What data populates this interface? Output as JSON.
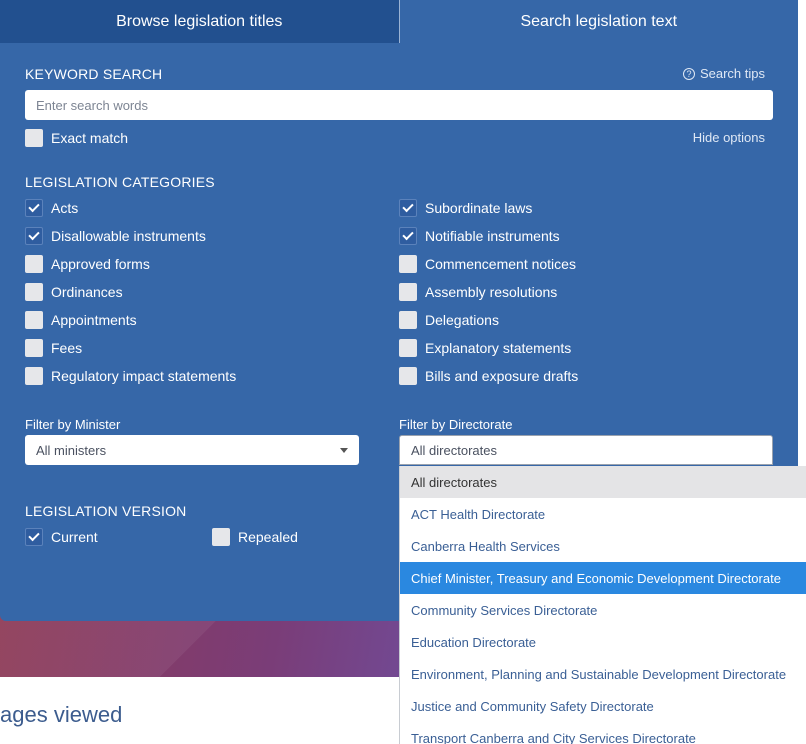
{
  "tabs": [
    {
      "label": "Browse legislation titles",
      "active": false
    },
    {
      "label": "Search legislation text",
      "active": true
    }
  ],
  "keyword_search": {
    "heading": "KEYWORD SEARCH",
    "search_tips": "Search tips",
    "placeholder": "Enter search words",
    "value": "",
    "exact_match_label": "Exact match",
    "exact_match_checked": false,
    "hide_options": "Hide options"
  },
  "categories": {
    "heading": "LEGISLATION CATEGORIES",
    "left": [
      {
        "label": "Acts",
        "checked": true
      },
      {
        "label": "Disallowable instruments",
        "checked": true
      },
      {
        "label": "Approved forms",
        "checked": false
      },
      {
        "label": "Ordinances",
        "checked": false
      },
      {
        "label": "Appointments",
        "checked": false
      },
      {
        "label": "Fees",
        "checked": false
      },
      {
        "label": "Regulatory impact statements",
        "checked": false
      }
    ],
    "right": [
      {
        "label": "Subordinate laws",
        "checked": true
      },
      {
        "label": "Notifiable instruments",
        "checked": true
      },
      {
        "label": "Commencement notices",
        "checked": false
      },
      {
        "label": "Assembly resolutions",
        "checked": false
      },
      {
        "label": "Delegations",
        "checked": false
      },
      {
        "label": "Explanatory statements",
        "checked": false
      },
      {
        "label": "Bills and exposure drafts",
        "checked": false
      }
    ]
  },
  "filters": {
    "minister_label": "Filter by Minister",
    "minister_value": "All ministers",
    "directorate_label": "Filter by Directorate",
    "directorate_value": "All directorates",
    "directorate_options": [
      "All directorates",
      "ACT Health Directorate",
      "Canberra Health Services",
      "Chief Minister, Treasury and Economic Development Directorate",
      "Community Services Directorate",
      "Education Directorate",
      "Environment, Planning and Sustainable Development Directorate",
      "Justice and Community Safety Directorate",
      "Transport Canberra and City Services Directorate"
    ]
  },
  "version": {
    "heading": "LEGISLATION VERSION",
    "current_label": "Current",
    "current_checked": true,
    "repealed_label": "Repealed",
    "repealed_checked": false
  },
  "footer": {
    "pages_viewed": "ages viewed"
  },
  "colors": {
    "panel": "#3667a8",
    "inactive_tab": "#22508f",
    "highlight": "#2a88e0"
  }
}
